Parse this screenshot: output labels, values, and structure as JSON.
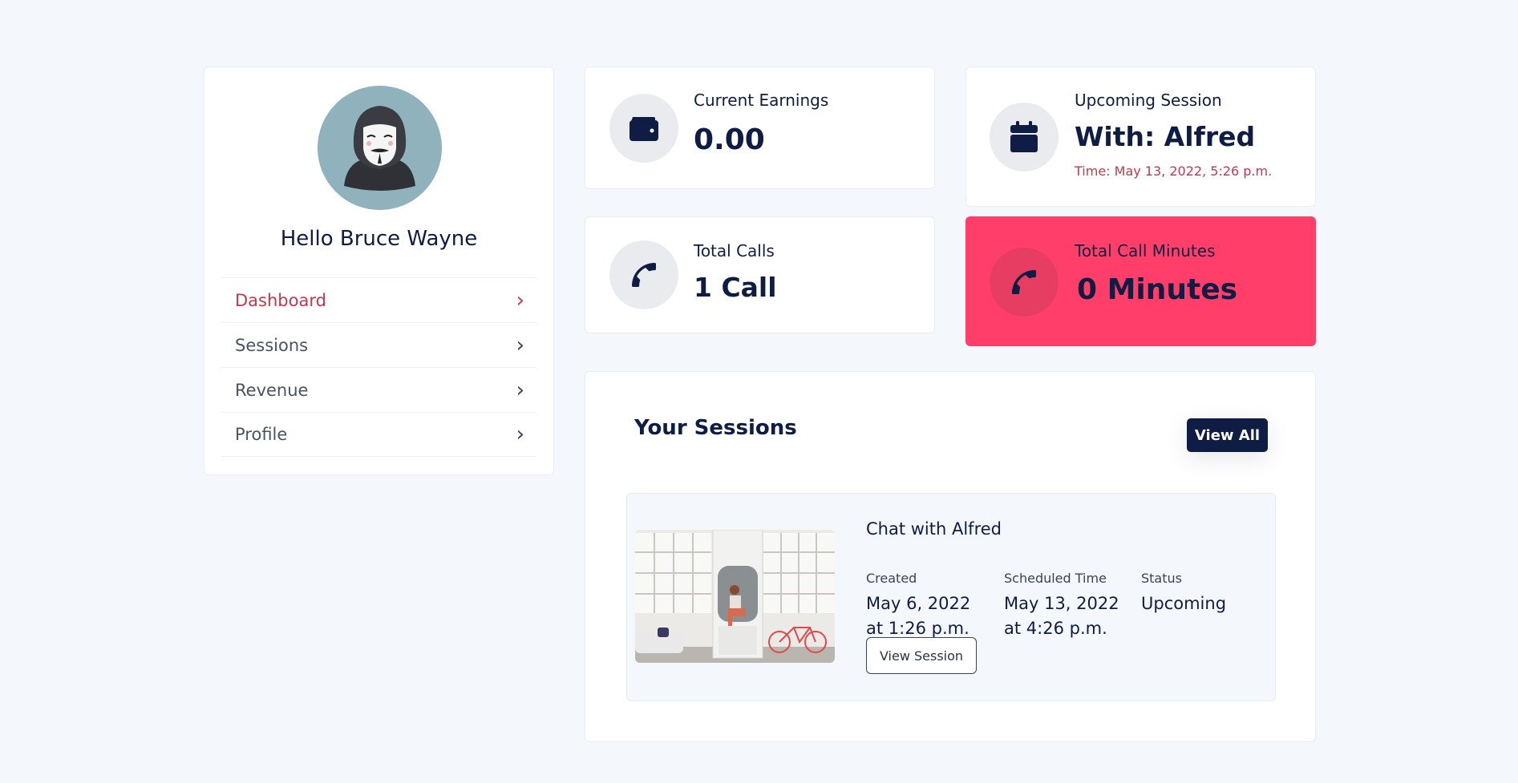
{
  "user": {
    "greeting": "Hello Bruce Wayne"
  },
  "nav": {
    "items": [
      {
        "label": "Dashboard",
        "active": true
      },
      {
        "label": "Sessions"
      },
      {
        "label": "Revenue"
      },
      {
        "label": "Profile"
      }
    ]
  },
  "stats": {
    "earnings": {
      "label": "Current Earnings",
      "value": "0.00",
      "icon": "wallet-icon"
    },
    "upcoming": {
      "label": "Upcoming Session",
      "value": "With: Alfred",
      "time": "Time: May 13, 2022, 5:26 p.m.",
      "icon": "calendar-icon"
    },
    "calls": {
      "label": "Total Calls",
      "value": "1 Call",
      "icon": "phone-icon"
    },
    "minutes": {
      "label": "Total Call Minutes",
      "value": "0 Minutes",
      "icon": "phone-icon"
    }
  },
  "sessions": {
    "title": "Your Sessions",
    "view_all": "View All",
    "items": [
      {
        "title": "Chat with Alfred",
        "created_label": "Created",
        "created_date": "May 6, 2022",
        "created_time": "at 1:26 p.m.",
        "scheduled_label": "Scheduled Time",
        "scheduled_date": "May 13, 2022",
        "scheduled_time": "at 4:26 p.m.",
        "status_label": "Status",
        "status": "Upcoming",
        "view_button": "View Session"
      }
    ]
  },
  "colors": {
    "navy": "#0f1c44",
    "accent_red": "#c0394f",
    "highlight_pink": "#ff3f69",
    "background": "#f4f7fc"
  }
}
